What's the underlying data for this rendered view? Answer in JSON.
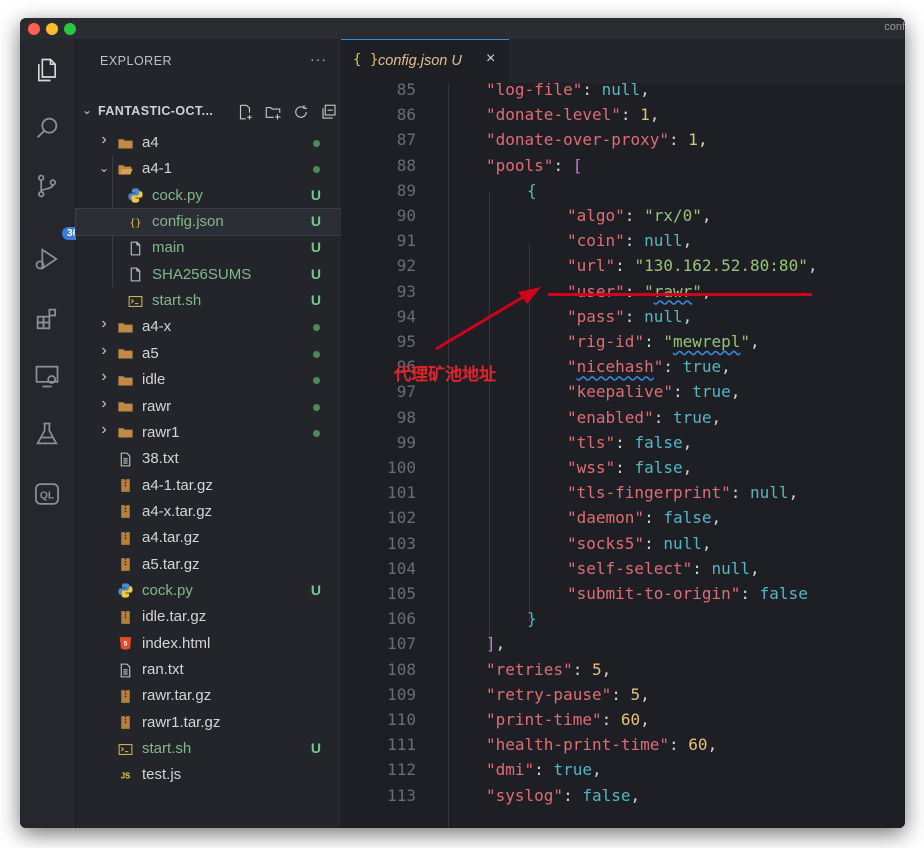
{
  "window": {
    "title": "conf"
  },
  "activity_bar": {
    "items": [
      {
        "name": "explorer-icon"
      },
      {
        "name": "search-icon"
      },
      {
        "name": "source-control-icon"
      },
      {
        "name": "run-debug-icon"
      },
      {
        "name": "extensions-icon"
      },
      {
        "name": "remote-explorer-icon"
      },
      {
        "name": "testing-icon"
      },
      {
        "name": "ql-icon",
        "text": "QL"
      }
    ],
    "scm_badge": "36"
  },
  "sidebar": {
    "title": "EXPLORER",
    "more": "···",
    "project": "FANTASTIC-OCT...",
    "tree": [
      {
        "label": "a4",
        "type": "folder",
        "depth": 0,
        "expanded": false,
        "status": "dot"
      },
      {
        "label": "a4-1",
        "type": "folder",
        "depth": 0,
        "expanded": true,
        "status": "dot"
      },
      {
        "label": "cock.py",
        "type": "python",
        "depth": 1,
        "status": "U"
      },
      {
        "label": "config.json",
        "type": "json",
        "depth": 1,
        "status": "U",
        "selected": true
      },
      {
        "label": "main",
        "type": "file",
        "depth": 1,
        "status": "U"
      },
      {
        "label": "SHA256SUMS",
        "type": "file",
        "depth": 1,
        "status": "U"
      },
      {
        "label": "start.sh",
        "type": "shell",
        "depth": 1,
        "status": "U"
      },
      {
        "label": "a4-x",
        "type": "folder",
        "depth": 0,
        "expanded": false,
        "status": "dot"
      },
      {
        "label": "a5",
        "type": "folder",
        "depth": 0,
        "expanded": false,
        "status": "dot"
      },
      {
        "label": "idle",
        "type": "folder",
        "depth": 0,
        "expanded": false,
        "status": "dot"
      },
      {
        "label": "rawr",
        "type": "folder",
        "depth": 0,
        "expanded": false,
        "status": "dot"
      },
      {
        "label": "rawr1",
        "type": "folder",
        "depth": 0,
        "expanded": false,
        "status": "dot"
      },
      {
        "label": "38.txt",
        "type": "text",
        "depth": 0
      },
      {
        "label": "a4-1.tar.gz",
        "type": "archive",
        "depth": 0
      },
      {
        "label": "a4-x.tar.gz",
        "type": "archive",
        "depth": 0
      },
      {
        "label": "a4.tar.gz",
        "type": "archive",
        "depth": 0
      },
      {
        "label": "a5.tar.gz",
        "type": "archive",
        "depth": 0
      },
      {
        "label": "cock.py",
        "type": "python",
        "depth": 0,
        "status": "U"
      },
      {
        "label": "idle.tar.gz",
        "type": "archive",
        "depth": 0
      },
      {
        "label": "index.html",
        "type": "html",
        "depth": 0
      },
      {
        "label": "ran.txt",
        "type": "text",
        "depth": 0
      },
      {
        "label": "rawr.tar.gz",
        "type": "archive",
        "depth": 0
      },
      {
        "label": "rawr1.tar.gz",
        "type": "archive",
        "depth": 0
      },
      {
        "label": "start.sh",
        "type": "shell",
        "depth": 0,
        "status": "U"
      },
      {
        "label": "test.js",
        "type": "js",
        "depth": 0
      }
    ]
  },
  "editor": {
    "tab": {
      "icon": "{ }",
      "name": "config.json",
      "status": "U",
      "close": "×"
    },
    "lines": [
      {
        "n": "85",
        "i": 1,
        "t": [
          [
            "k",
            "\"log-file\""
          ],
          [
            "x",
            ": "
          ],
          [
            "c",
            "null"
          ],
          [
            "x",
            ","
          ]
        ]
      },
      {
        "n": "86",
        "i": 1,
        "t": [
          [
            "k",
            "\"donate-level\""
          ],
          [
            "x",
            ": "
          ],
          [
            "n",
            "1"
          ],
          [
            "x",
            ","
          ]
        ]
      },
      {
        "n": "87",
        "i": 1,
        "t": [
          [
            "k",
            "\"donate-over-proxy\""
          ],
          [
            "x",
            ": "
          ],
          [
            "n",
            "1"
          ],
          [
            "x",
            ","
          ]
        ]
      },
      {
        "n": "88",
        "i": 1,
        "t": [
          [
            "k",
            "\"pools\""
          ],
          [
            "x",
            ": "
          ],
          [
            "p",
            "["
          ]
        ]
      },
      {
        "n": "89",
        "i": 2,
        "t": [
          [
            "c",
            "{"
          ]
        ]
      },
      {
        "n": "90",
        "i": 3,
        "t": [
          [
            "k",
            "\"algo\""
          ],
          [
            "x",
            ": "
          ],
          [
            "s",
            "\"rx/0\""
          ],
          [
            "x",
            ","
          ]
        ]
      },
      {
        "n": "91",
        "i": 3,
        "t": [
          [
            "k",
            "\"coin\""
          ],
          [
            "x",
            ": "
          ],
          [
            "c",
            "null"
          ],
          [
            "x",
            ","
          ]
        ]
      },
      {
        "n": "92",
        "i": 3,
        "t": [
          [
            "k",
            "\"url\""
          ],
          [
            "x",
            ": "
          ],
          [
            "s",
            "\"130.162.52.80:80\""
          ],
          [
            "x",
            ","
          ]
        ]
      },
      {
        "n": "93",
        "i": 3,
        "t": [
          [
            "k",
            "\"user\""
          ],
          [
            "x",
            ": "
          ],
          [
            "s",
            "\""
          ],
          [
            "sq",
            "rawr"
          ],
          [
            "s",
            "\""
          ],
          [
            "x",
            ","
          ]
        ]
      },
      {
        "n": "94",
        "i": 3,
        "t": [
          [
            "k",
            "\"pass\""
          ],
          [
            "x",
            ": "
          ],
          [
            "c",
            "null"
          ],
          [
            "x",
            ","
          ]
        ]
      },
      {
        "n": "95",
        "i": 3,
        "t": [
          [
            "k",
            "\"rig-id\""
          ],
          [
            "x",
            ": "
          ],
          [
            "s",
            "\""
          ],
          [
            "sq",
            "mewrepl"
          ],
          [
            "s",
            "\""
          ],
          [
            "x",
            ","
          ]
        ]
      },
      {
        "n": "96",
        "i": 3,
        "t": [
          [
            "k",
            "\""
          ],
          [
            "ksq",
            "nicehash"
          ],
          [
            "k",
            "\""
          ],
          [
            "x",
            ": "
          ],
          [
            "c",
            "true"
          ],
          [
            "x",
            ","
          ]
        ]
      },
      {
        "n": "97",
        "i": 3,
        "t": [
          [
            "k",
            "\"keepalive\""
          ],
          [
            "x",
            ": "
          ],
          [
            "c",
            "true"
          ],
          [
            "x",
            ","
          ]
        ]
      },
      {
        "n": "98",
        "i": 3,
        "t": [
          [
            "k",
            "\"enabled\""
          ],
          [
            "x",
            ": "
          ],
          [
            "c",
            "true"
          ],
          [
            "x",
            ","
          ]
        ]
      },
      {
        "n": "99",
        "i": 3,
        "t": [
          [
            "k",
            "\"tls\""
          ],
          [
            "x",
            ": "
          ],
          [
            "c",
            "false"
          ],
          [
            "x",
            ","
          ]
        ]
      },
      {
        "n": "100",
        "i": 3,
        "t": [
          [
            "k",
            "\"wss\""
          ],
          [
            "x",
            ": "
          ],
          [
            "c",
            "false"
          ],
          [
            "x",
            ","
          ]
        ]
      },
      {
        "n": "101",
        "i": 3,
        "t": [
          [
            "k",
            "\"tls-fingerprint\""
          ],
          [
            "x",
            ": "
          ],
          [
            "c",
            "null"
          ],
          [
            "x",
            ","
          ]
        ]
      },
      {
        "n": "102",
        "i": 3,
        "t": [
          [
            "k",
            "\"daemon\""
          ],
          [
            "x",
            ": "
          ],
          [
            "c",
            "false"
          ],
          [
            "x",
            ","
          ]
        ]
      },
      {
        "n": "103",
        "i": 3,
        "t": [
          [
            "k",
            "\"socks5\""
          ],
          [
            "x",
            ": "
          ],
          [
            "c",
            "null"
          ],
          [
            "x",
            ","
          ]
        ]
      },
      {
        "n": "104",
        "i": 3,
        "t": [
          [
            "k",
            "\"self-select\""
          ],
          [
            "x",
            ": "
          ],
          [
            "c",
            "null"
          ],
          [
            "x",
            ","
          ]
        ]
      },
      {
        "n": "105",
        "i": 3,
        "t": [
          [
            "k",
            "\"submit-to-origin\""
          ],
          [
            "x",
            ": "
          ],
          [
            "c",
            "false"
          ]
        ]
      },
      {
        "n": "106",
        "i": 2,
        "t": [
          [
            "c",
            "}"
          ]
        ]
      },
      {
        "n": "107",
        "i": 1,
        "t": [
          [
            "p",
            "]"
          ],
          [
            "x",
            ","
          ]
        ]
      },
      {
        "n": "108",
        "i": 1,
        "t": [
          [
            "k",
            "\"retries\""
          ],
          [
            "x",
            ": "
          ],
          [
            "n",
            "5"
          ],
          [
            "x",
            ","
          ]
        ]
      },
      {
        "n": "109",
        "i": 1,
        "t": [
          [
            "k",
            "\"retry-pause\""
          ],
          [
            "x",
            ": "
          ],
          [
            "n",
            "5"
          ],
          [
            "x",
            ","
          ]
        ]
      },
      {
        "n": "110",
        "i": 1,
        "t": [
          [
            "k",
            "\"print-time\""
          ],
          [
            "x",
            ": "
          ],
          [
            "n",
            "60"
          ],
          [
            "x",
            ","
          ]
        ]
      },
      {
        "n": "111",
        "i": 1,
        "t": [
          [
            "k",
            "\"health-print-time\""
          ],
          [
            "x",
            ": "
          ],
          [
            "n",
            "60"
          ],
          [
            "x",
            ","
          ]
        ]
      },
      {
        "n": "112",
        "i": 1,
        "t": [
          [
            "k",
            "\"dmi\""
          ],
          [
            "x",
            ": "
          ],
          [
            "c",
            "true"
          ],
          [
            "x",
            ","
          ]
        ]
      },
      {
        "n": "113",
        "i": 1,
        "t": [
          [
            "k",
            "\"syslog\""
          ],
          [
            "x",
            ": "
          ],
          [
            "c",
            "false"
          ],
          [
            "x",
            ","
          ]
        ]
      }
    ]
  },
  "annotation": {
    "text": "代理矿池地址",
    "color": "#e0242c"
  }
}
